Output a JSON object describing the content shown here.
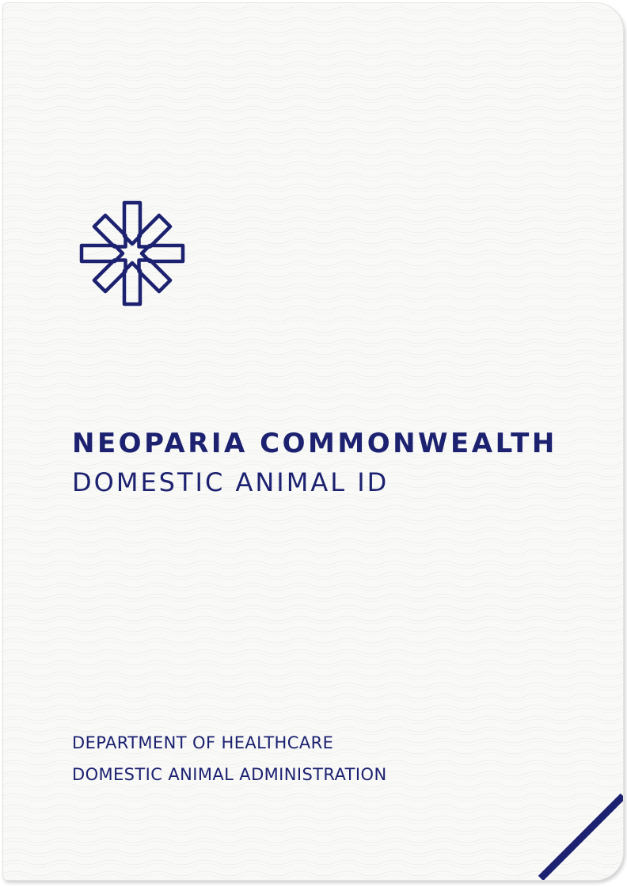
{
  "cover": {
    "title": "NEOPARIA COMMONWEALTH",
    "subtitle": "DOMESTIC ANIMAL ID",
    "department_lines": [
      "DEPARTMENT OF HEALTHCARE",
      "DOMESTIC ANIMAL ADMINISTRATION"
    ],
    "emblem_icon": "eight-point-star-emblem-icon",
    "ribbon": "corner-ribbon"
  },
  "colors": {
    "ink": "#1c2170",
    "paper": "#f9f9f8"
  }
}
